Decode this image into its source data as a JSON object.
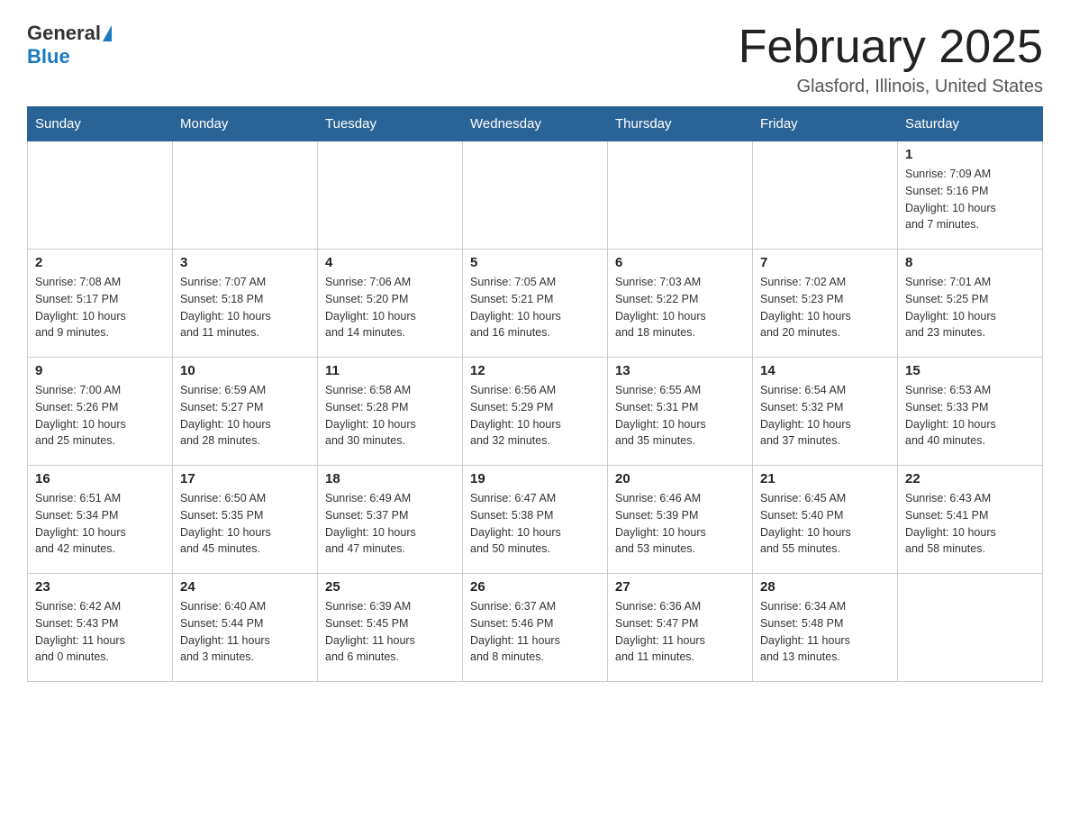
{
  "header": {
    "logo_general": "General",
    "logo_blue": "Blue",
    "month_title": "February 2025",
    "location": "Glasford, Illinois, United States"
  },
  "days_of_week": [
    "Sunday",
    "Monday",
    "Tuesday",
    "Wednesday",
    "Thursday",
    "Friday",
    "Saturday"
  ],
  "weeks": [
    [
      {
        "num": "",
        "info": ""
      },
      {
        "num": "",
        "info": ""
      },
      {
        "num": "",
        "info": ""
      },
      {
        "num": "",
        "info": ""
      },
      {
        "num": "",
        "info": ""
      },
      {
        "num": "",
        "info": ""
      },
      {
        "num": "1",
        "info": "Sunrise: 7:09 AM\nSunset: 5:16 PM\nDaylight: 10 hours\nand 7 minutes."
      }
    ],
    [
      {
        "num": "2",
        "info": "Sunrise: 7:08 AM\nSunset: 5:17 PM\nDaylight: 10 hours\nand 9 minutes."
      },
      {
        "num": "3",
        "info": "Sunrise: 7:07 AM\nSunset: 5:18 PM\nDaylight: 10 hours\nand 11 minutes."
      },
      {
        "num": "4",
        "info": "Sunrise: 7:06 AM\nSunset: 5:20 PM\nDaylight: 10 hours\nand 14 minutes."
      },
      {
        "num": "5",
        "info": "Sunrise: 7:05 AM\nSunset: 5:21 PM\nDaylight: 10 hours\nand 16 minutes."
      },
      {
        "num": "6",
        "info": "Sunrise: 7:03 AM\nSunset: 5:22 PM\nDaylight: 10 hours\nand 18 minutes."
      },
      {
        "num": "7",
        "info": "Sunrise: 7:02 AM\nSunset: 5:23 PM\nDaylight: 10 hours\nand 20 minutes."
      },
      {
        "num": "8",
        "info": "Sunrise: 7:01 AM\nSunset: 5:25 PM\nDaylight: 10 hours\nand 23 minutes."
      }
    ],
    [
      {
        "num": "9",
        "info": "Sunrise: 7:00 AM\nSunset: 5:26 PM\nDaylight: 10 hours\nand 25 minutes."
      },
      {
        "num": "10",
        "info": "Sunrise: 6:59 AM\nSunset: 5:27 PM\nDaylight: 10 hours\nand 28 minutes."
      },
      {
        "num": "11",
        "info": "Sunrise: 6:58 AM\nSunset: 5:28 PM\nDaylight: 10 hours\nand 30 minutes."
      },
      {
        "num": "12",
        "info": "Sunrise: 6:56 AM\nSunset: 5:29 PM\nDaylight: 10 hours\nand 32 minutes."
      },
      {
        "num": "13",
        "info": "Sunrise: 6:55 AM\nSunset: 5:31 PM\nDaylight: 10 hours\nand 35 minutes."
      },
      {
        "num": "14",
        "info": "Sunrise: 6:54 AM\nSunset: 5:32 PM\nDaylight: 10 hours\nand 37 minutes."
      },
      {
        "num": "15",
        "info": "Sunrise: 6:53 AM\nSunset: 5:33 PM\nDaylight: 10 hours\nand 40 minutes."
      }
    ],
    [
      {
        "num": "16",
        "info": "Sunrise: 6:51 AM\nSunset: 5:34 PM\nDaylight: 10 hours\nand 42 minutes."
      },
      {
        "num": "17",
        "info": "Sunrise: 6:50 AM\nSunset: 5:35 PM\nDaylight: 10 hours\nand 45 minutes."
      },
      {
        "num": "18",
        "info": "Sunrise: 6:49 AM\nSunset: 5:37 PM\nDaylight: 10 hours\nand 47 minutes."
      },
      {
        "num": "19",
        "info": "Sunrise: 6:47 AM\nSunset: 5:38 PM\nDaylight: 10 hours\nand 50 minutes."
      },
      {
        "num": "20",
        "info": "Sunrise: 6:46 AM\nSunset: 5:39 PM\nDaylight: 10 hours\nand 53 minutes."
      },
      {
        "num": "21",
        "info": "Sunrise: 6:45 AM\nSunset: 5:40 PM\nDaylight: 10 hours\nand 55 minutes."
      },
      {
        "num": "22",
        "info": "Sunrise: 6:43 AM\nSunset: 5:41 PM\nDaylight: 10 hours\nand 58 minutes."
      }
    ],
    [
      {
        "num": "23",
        "info": "Sunrise: 6:42 AM\nSunset: 5:43 PM\nDaylight: 11 hours\nand 0 minutes."
      },
      {
        "num": "24",
        "info": "Sunrise: 6:40 AM\nSunset: 5:44 PM\nDaylight: 11 hours\nand 3 minutes."
      },
      {
        "num": "25",
        "info": "Sunrise: 6:39 AM\nSunset: 5:45 PM\nDaylight: 11 hours\nand 6 minutes."
      },
      {
        "num": "26",
        "info": "Sunrise: 6:37 AM\nSunset: 5:46 PM\nDaylight: 11 hours\nand 8 minutes."
      },
      {
        "num": "27",
        "info": "Sunrise: 6:36 AM\nSunset: 5:47 PM\nDaylight: 11 hours\nand 11 minutes."
      },
      {
        "num": "28",
        "info": "Sunrise: 6:34 AM\nSunset: 5:48 PM\nDaylight: 11 hours\nand 13 minutes."
      },
      {
        "num": "",
        "info": ""
      }
    ]
  ]
}
